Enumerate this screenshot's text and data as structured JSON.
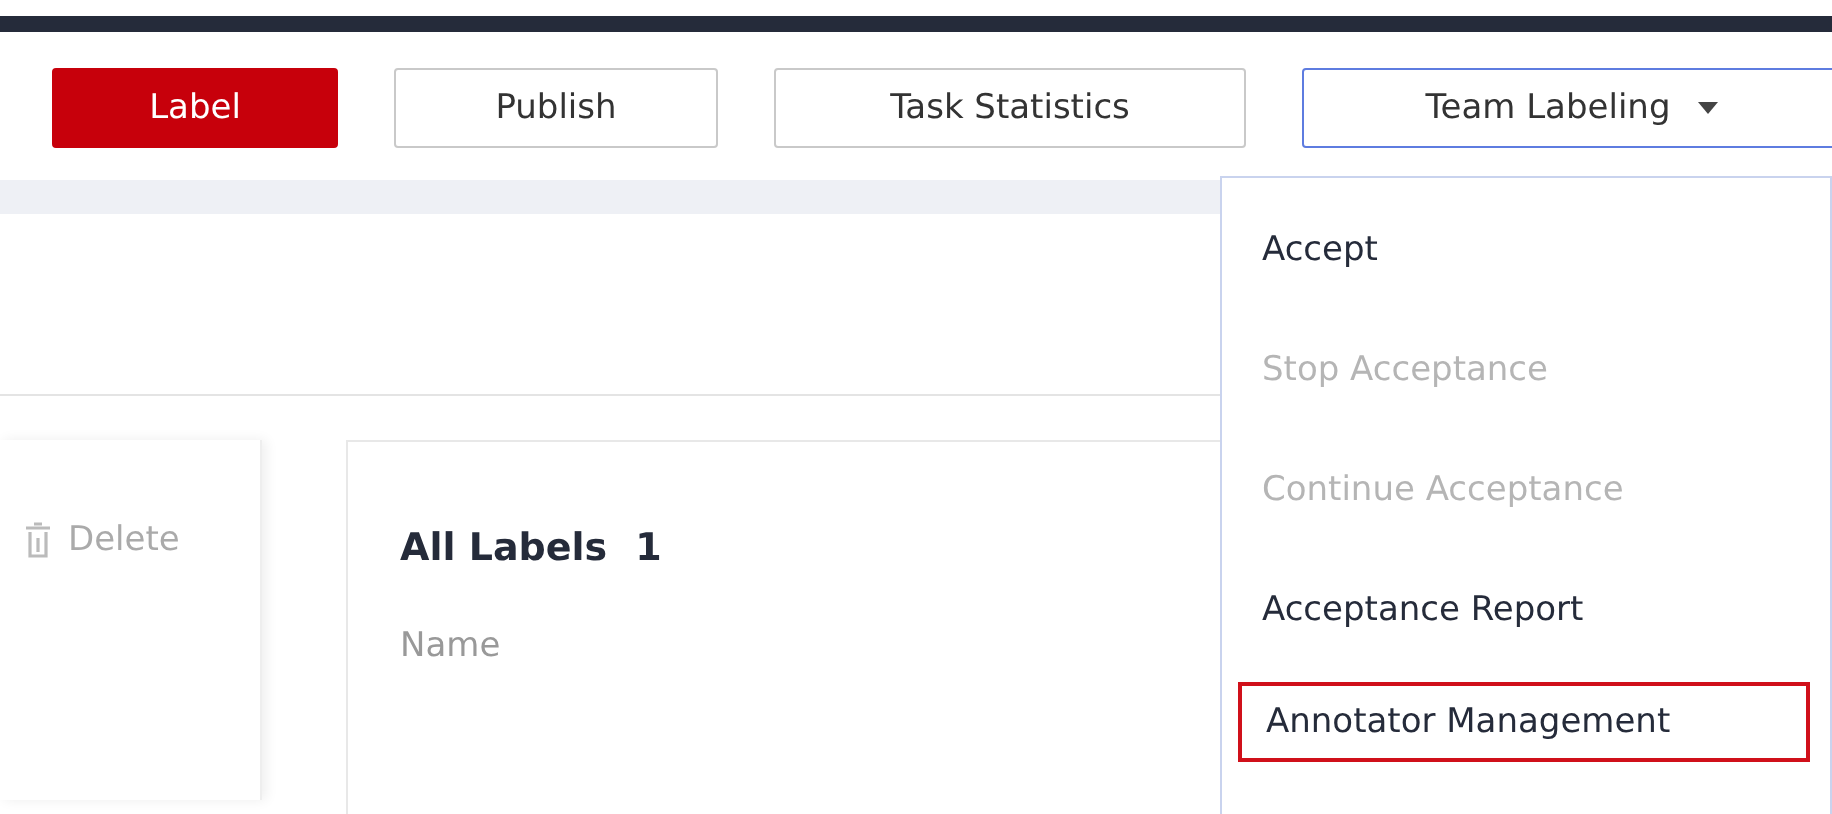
{
  "toolbar": {
    "buttons": [
      {
        "label": "Label",
        "primary": true
      },
      {
        "label": "Publish",
        "primary": false
      },
      {
        "label": "Task Statistics",
        "primary": false
      }
    ],
    "dropdown": {
      "label": "Team Labeling",
      "expanded": true
    }
  },
  "menu": [
    {
      "label": "Accept",
      "disabled": false,
      "highlighted": false
    },
    {
      "label": "Stop Acceptance",
      "disabled": true,
      "highlighted": false
    },
    {
      "label": "Continue Acceptance",
      "disabled": true,
      "highlighted": false
    },
    {
      "label": "Acceptance Report",
      "disabled": false,
      "highlighted": false
    },
    {
      "label": "Annotator Management",
      "disabled": false,
      "highlighted": true
    }
  ],
  "left_panel": {
    "delete_button": "Delete"
  },
  "labels_card": {
    "title": "All Labels",
    "count": "1",
    "column": "Name"
  }
}
